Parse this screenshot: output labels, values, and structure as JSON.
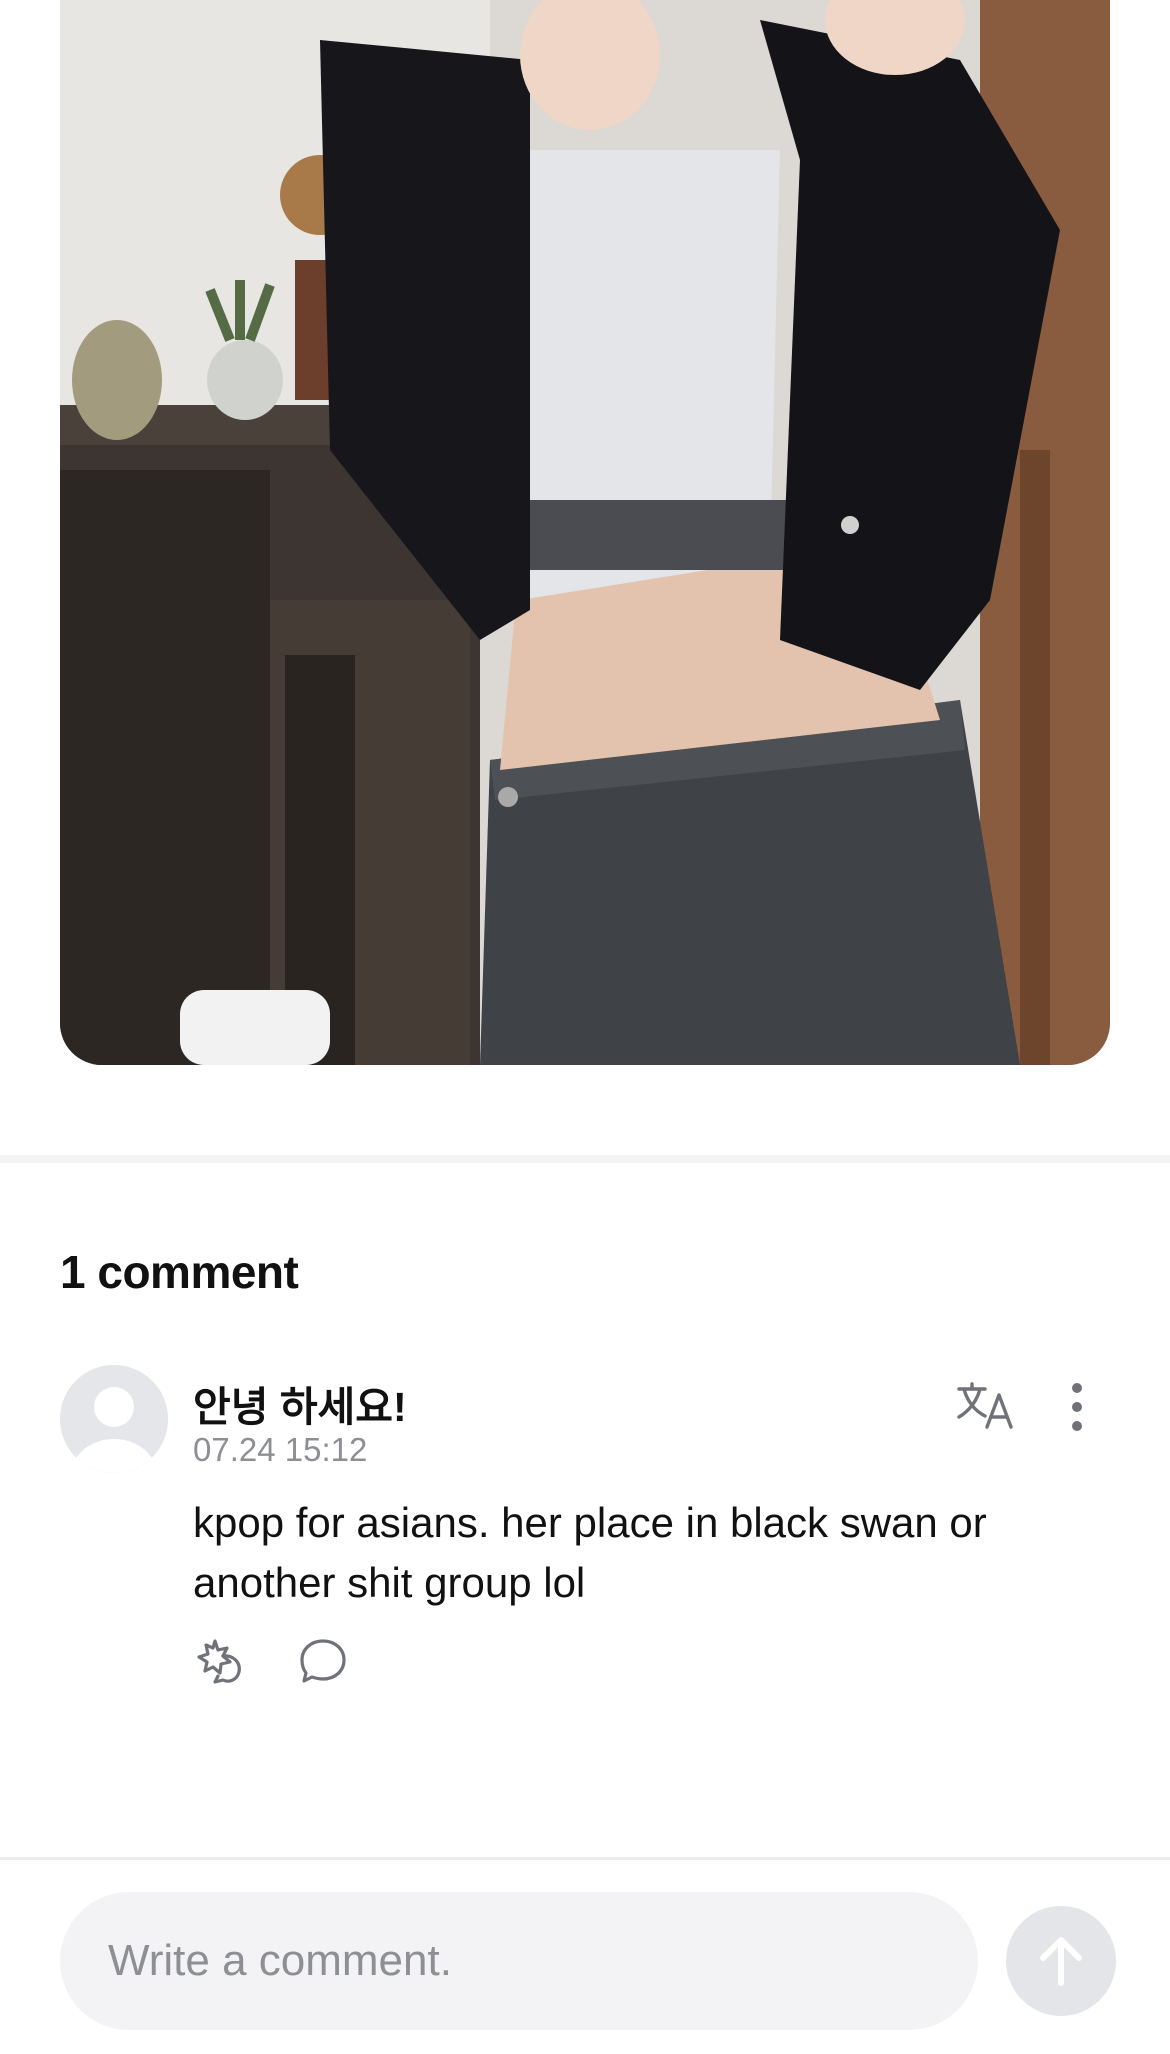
{
  "comments": {
    "count_label": "1 comment",
    "items": [
      {
        "author": "안녕 하세요!",
        "timestamp": "07.24 15:12",
        "body": "kpop for asians. her place in black swan or another shit group lol"
      }
    ]
  },
  "composer": {
    "placeholder": "Write a comment."
  },
  "colors": {
    "muted_text": "#8d8f94",
    "input_bg": "#f3f3f5",
    "send_button_bg": "#e3e5e9"
  },
  "icons": {
    "translate": "translate-icon",
    "more": "more-vertical-icon",
    "react": "sticker-react-icon",
    "reply": "reply-bubble-icon",
    "send": "arrow-up-icon"
  }
}
